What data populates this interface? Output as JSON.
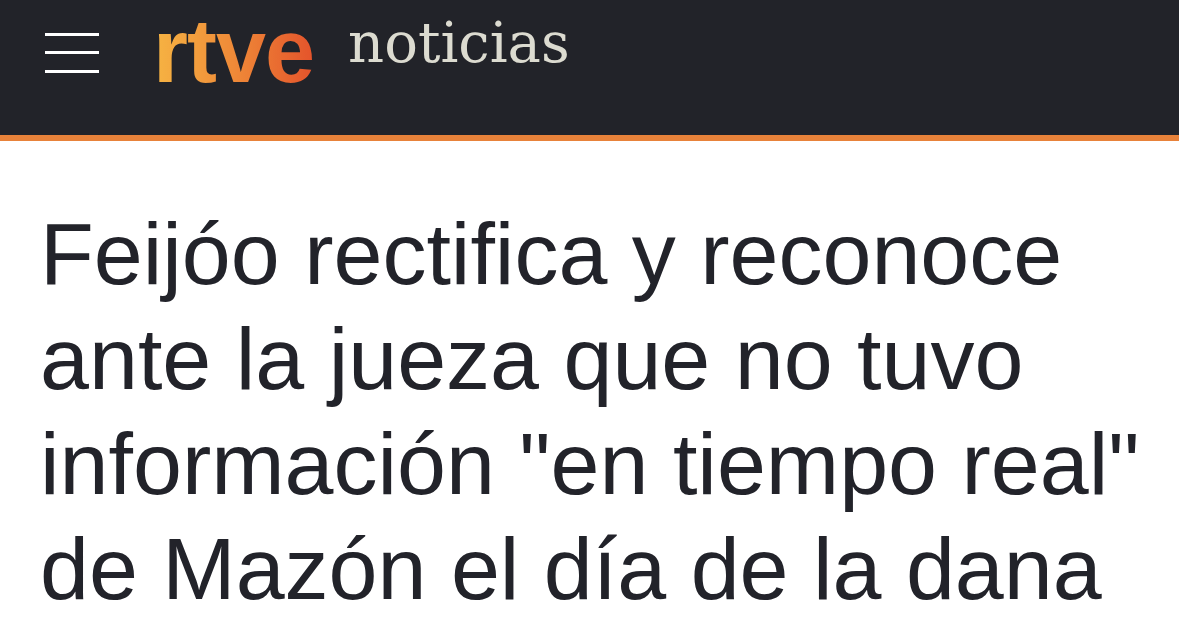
{
  "header": {
    "logo": "rtve",
    "section": "noticias"
  },
  "article": {
    "headline": "Feijóo rectifica y reconoce ante la jueza que no tuvo información \"en tiempo real\" de Mazón el día de la dana"
  }
}
